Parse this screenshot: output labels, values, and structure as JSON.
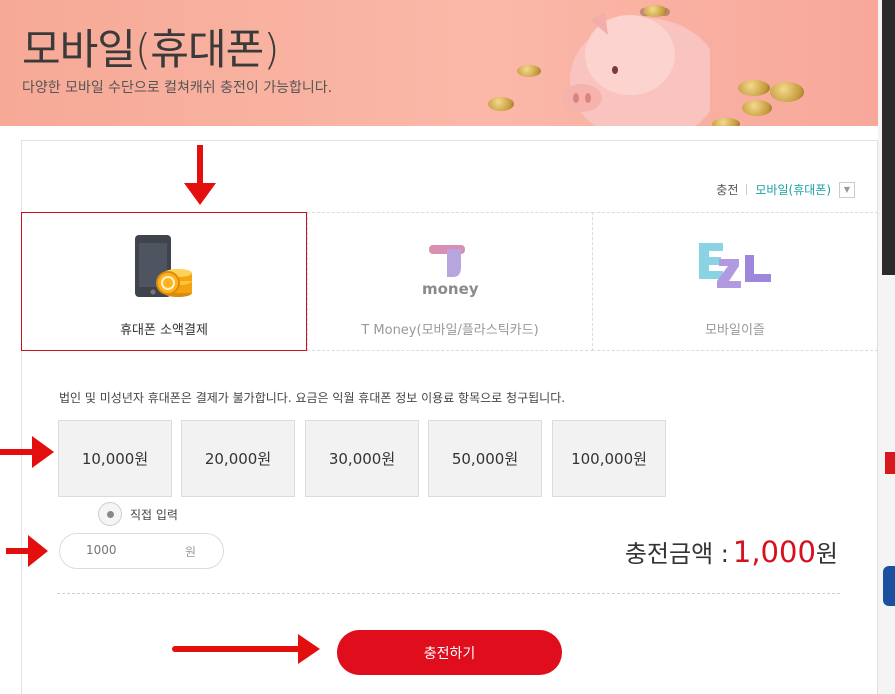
{
  "banner": {
    "title": "모바일(휴대폰)",
    "subtitle": "다양한 모바일 수단으로 컬쳐캐쉬 충전이 가능합니다."
  },
  "breadcrumb": {
    "parent": "충전",
    "current": "모바일(휴대폰)"
  },
  "methods": [
    {
      "label": "휴대폰 소액결제",
      "icon": "phone-coins-icon",
      "selected": true
    },
    {
      "label": "T Money(모바일/플라스틱카드)",
      "icon": "tmoney-logo",
      "logo_text": "money",
      "selected": false
    },
    {
      "label": "모바일이즐",
      "icon": "ezl-logo",
      "logo_text": "EZL",
      "selected": false
    }
  ],
  "notice": "법인 및 미성년자 휴대폰은 결제가 불가합니다. 요금은 익월 휴대폰 정보 이용료 항목으로 청구됩니다.",
  "amounts": [
    "10,000원",
    "20,000원",
    "30,000원",
    "50,000원",
    "100,000원"
  ],
  "direct_input": {
    "label": "직접 입력",
    "placeholder": "1000",
    "unit": "원"
  },
  "total": {
    "label": "충전금액 :",
    "value": "1,000",
    "unit": "원"
  },
  "submit_label": "충전하기",
  "colors": {
    "accent_red": "#e00d1c",
    "selected_border": "#c8101e",
    "breadcrumb_current": "#1aa3a3",
    "banner_bg": "#f7ad9c"
  }
}
